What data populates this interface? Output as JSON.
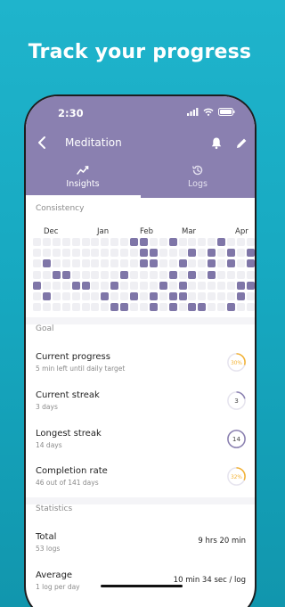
{
  "headline": "Track your progress",
  "status_bar": {
    "time": "2:30"
  },
  "nav": {
    "title": "Meditation"
  },
  "tabs": [
    {
      "label": "Insights",
      "icon": "chart-line-icon",
      "active": true
    },
    {
      "label": "Logs",
      "icon": "history-icon",
      "active": false
    }
  ],
  "consistency": {
    "label": "Consistency",
    "months": [
      "Dec",
      "Jan",
      "Feb",
      "Mar",
      "Apr"
    ]
  },
  "goal": {
    "label": "Goal",
    "rows": [
      {
        "title": "Current progress",
        "subtitle": "5 min left until daily target",
        "ring_text": "30%",
        "ring_fraction": 0.3,
        "ring_color": "#f3b233"
      },
      {
        "title": "Current streak",
        "subtitle": "3 days",
        "ring_text": "3",
        "ring_fraction": 0.21,
        "ring_color": "#8a80b0"
      },
      {
        "title": "Longest streak",
        "subtitle": "14 days",
        "ring_text": "14",
        "ring_fraction": 1.0,
        "ring_color": "#8a80b0"
      },
      {
        "title": "Completion rate",
        "subtitle": "46 out of 141 days",
        "ring_text": "32%",
        "ring_fraction": 0.32,
        "ring_color": "#f3b233"
      }
    ]
  },
  "statistics": {
    "label": "Statistics",
    "rows": [
      {
        "title": "Total",
        "subtitle": "53 logs",
        "value": "9 hrs 20 min"
      },
      {
        "title": "Average",
        "subtitle": "1 log per day",
        "value": "10 min 34 sec / log"
      }
    ]
  },
  "colors": {
    "accent_purple": "#8a80b0",
    "accent_orange": "#f3b233",
    "cell_filled": "#7f76a8",
    "cell_empty": "#efeff3"
  }
}
